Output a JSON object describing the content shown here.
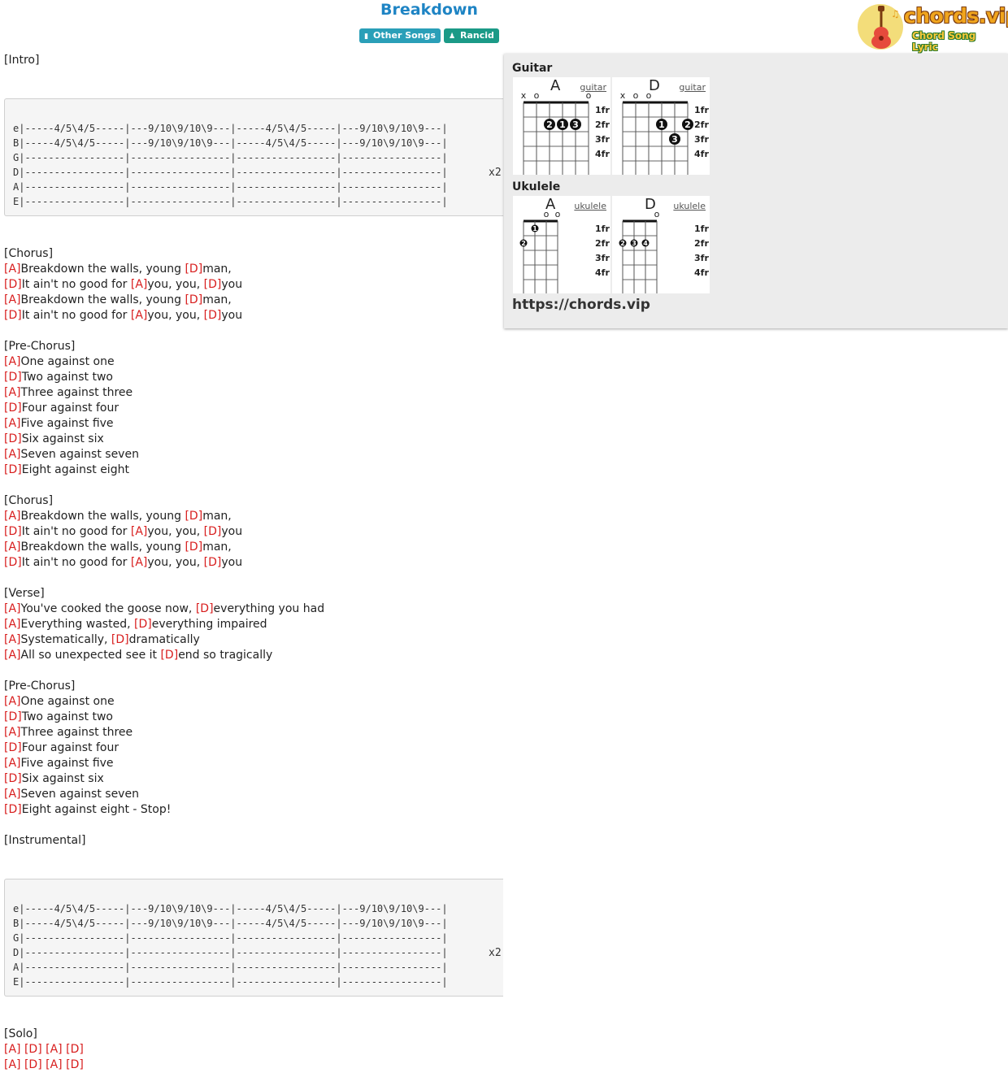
{
  "song": {
    "title": "Breakdown"
  },
  "tags": {
    "category": "Other Songs",
    "artist": "Rancid"
  },
  "logo": {
    "name": "chords.vip",
    "tagline": "Chord Song Lyric"
  },
  "panel": {
    "guitar_label": "Guitar",
    "ukulele_label": "Ukulele",
    "site_url": "https://chords.vip",
    "chords": [
      {
        "name": "A",
        "instrument": "guitar",
        "link": "guitar",
        "open_muted": [
          "x",
          "o",
          "",
          "",
          "",
          "o"
        ],
        "dots": [
          {
            "string": 2,
            "fret": 2,
            "finger": "2"
          },
          {
            "string": 3,
            "fret": 2,
            "finger": "1"
          },
          {
            "string": 4,
            "fret": 2,
            "finger": "3"
          }
        ],
        "fret_labels": [
          "1fr",
          "2fr",
          "3fr",
          "4fr"
        ]
      },
      {
        "name": "D",
        "instrument": "guitar",
        "link": "guitar",
        "open_muted": [
          "x",
          "o",
          "o",
          "",
          "",
          ""
        ],
        "dots": [
          {
            "string": 3,
            "fret": 2,
            "finger": "1"
          },
          {
            "string": 5,
            "fret": 2,
            "finger": "2"
          },
          {
            "string": 4,
            "fret": 3,
            "finger": "3"
          }
        ],
        "fret_labels": [
          "1fr",
          "2fr",
          "3fr",
          "4fr"
        ]
      },
      {
        "name": "A",
        "instrument": "ukulele",
        "link": "ukulele",
        "open_muted": [
          "",
          "",
          "o",
          "o"
        ],
        "dots": [
          {
            "string": 0,
            "fret": 2,
            "finger": "2"
          },
          {
            "string": 1,
            "fret": 1,
            "finger": "1"
          }
        ],
        "fret_labels": [
          "1fr",
          "2fr",
          "3fr",
          "4fr"
        ]
      },
      {
        "name": "D",
        "instrument": "ukulele",
        "link": "ukulele",
        "open_muted": [
          "",
          "",
          "",
          "o"
        ],
        "dots": [
          {
            "string": 0,
            "fret": 2,
            "finger": "2"
          },
          {
            "string": 1,
            "fret": 2,
            "finger": "3"
          },
          {
            "string": 2,
            "fret": 2,
            "finger": "4"
          }
        ],
        "fret_labels": [
          "1fr",
          "2fr",
          "3fr",
          "4fr"
        ]
      }
    ]
  },
  "sheet": [
    {
      "type": "line",
      "parts": [
        {
          "t": "[Intro]"
        }
      ]
    },
    {
      "type": "blank"
    },
    {
      "type": "tab",
      "lines": [
        "e|-----4/5\\4/5-----|---9/10\\9/10\\9---|-----4/5\\4/5-----|---9/10\\9/10\\9---|",
        "B|-----4/5\\4/5-----|---9/10\\9/10\\9---|-----4/5\\4/5-----|---9/10\\9/10\\9---|",
        "G|-----------------|-----------------|-----------------|-----------------|",
        "D|-----------------|-----------------|-----------------|-----------------|",
        "A|-----------------|-----------------|-----------------|-----------------|",
        "E|-----------------|-----------------|-----------------|-----------------|"
      ],
      "repeat": "x2"
    },
    {
      "type": "blank"
    },
    {
      "type": "line",
      "parts": [
        {
          "t": "[Chorus]"
        }
      ]
    },
    {
      "type": "line",
      "parts": [
        {
          "c": "[A]"
        },
        {
          "t": "Breakdown the walls, young "
        },
        {
          "c": "[D]"
        },
        {
          "t": "man,"
        }
      ]
    },
    {
      "type": "line",
      "parts": [
        {
          "c": "[D]"
        },
        {
          "t": "It ain't no good for "
        },
        {
          "c": "[A]"
        },
        {
          "t": "you, you, "
        },
        {
          "c": "[D]"
        },
        {
          "t": "you"
        }
      ]
    },
    {
      "type": "line",
      "parts": [
        {
          "c": "[A]"
        },
        {
          "t": "Breakdown the walls, young "
        },
        {
          "c": "[D]"
        },
        {
          "t": "man,"
        }
      ]
    },
    {
      "type": "line",
      "parts": [
        {
          "c": "[D]"
        },
        {
          "t": "It ain't no good for "
        },
        {
          "c": "[A]"
        },
        {
          "t": "you, you, "
        },
        {
          "c": "[D]"
        },
        {
          "t": "you"
        }
      ]
    },
    {
      "type": "blank"
    },
    {
      "type": "line",
      "parts": [
        {
          "t": "[Pre-Chorus]"
        }
      ]
    },
    {
      "type": "line",
      "parts": [
        {
          "c": "[A]"
        },
        {
          "t": "One against one"
        }
      ]
    },
    {
      "type": "line",
      "parts": [
        {
          "c": "[D]"
        },
        {
          "t": "Two against two"
        }
      ]
    },
    {
      "type": "line",
      "parts": [
        {
          "c": "[A]"
        },
        {
          "t": "Three against three"
        }
      ]
    },
    {
      "type": "line",
      "parts": [
        {
          "c": "[D]"
        },
        {
          "t": "Four against four"
        }
      ]
    },
    {
      "type": "line",
      "parts": [
        {
          "c": "[A]"
        },
        {
          "t": "Five against five"
        }
      ]
    },
    {
      "type": "line",
      "parts": [
        {
          "c": "[D]"
        },
        {
          "t": "Six against six"
        }
      ]
    },
    {
      "type": "line",
      "parts": [
        {
          "c": "[A]"
        },
        {
          "t": "Seven against seven"
        }
      ]
    },
    {
      "type": "line",
      "parts": [
        {
          "c": "[D]"
        },
        {
          "t": "Eight against eight"
        }
      ]
    },
    {
      "type": "blank"
    },
    {
      "type": "line",
      "parts": [
        {
          "t": "[Chorus]"
        }
      ]
    },
    {
      "type": "line",
      "parts": [
        {
          "c": "[A]"
        },
        {
          "t": "Breakdown the walls, young "
        },
        {
          "c": "[D]"
        },
        {
          "t": "man,"
        }
      ]
    },
    {
      "type": "line",
      "parts": [
        {
          "c": "[D]"
        },
        {
          "t": "It ain't no good for "
        },
        {
          "c": "[A]"
        },
        {
          "t": "you, you, "
        },
        {
          "c": "[D]"
        },
        {
          "t": "you"
        }
      ]
    },
    {
      "type": "line",
      "parts": [
        {
          "c": "[A]"
        },
        {
          "t": "Breakdown the walls, young "
        },
        {
          "c": "[D]"
        },
        {
          "t": "man,"
        }
      ]
    },
    {
      "type": "line",
      "parts": [
        {
          "c": "[D]"
        },
        {
          "t": "It ain't no good for "
        },
        {
          "c": "[A]"
        },
        {
          "t": "you, you, "
        },
        {
          "c": "[D]"
        },
        {
          "t": "you"
        }
      ]
    },
    {
      "type": "blank"
    },
    {
      "type": "line",
      "parts": [
        {
          "t": "[Verse]"
        }
      ]
    },
    {
      "type": "line",
      "parts": [
        {
          "c": "[A]"
        },
        {
          "t": "You've cooked the goose now, "
        },
        {
          "c": "[D]"
        },
        {
          "t": "everything you had"
        }
      ]
    },
    {
      "type": "line",
      "parts": [
        {
          "c": "[A]"
        },
        {
          "t": "Everything wasted, "
        },
        {
          "c": "[D]"
        },
        {
          "t": "everything impaired"
        }
      ]
    },
    {
      "type": "line",
      "parts": [
        {
          "c": "[A]"
        },
        {
          "t": "Systematically, "
        },
        {
          "c": "[D]"
        },
        {
          "t": "dramatically"
        }
      ]
    },
    {
      "type": "line",
      "parts": [
        {
          "c": "[A]"
        },
        {
          "t": "All so unexpected see it "
        },
        {
          "c": "[D]"
        },
        {
          "t": "end so tragically"
        }
      ]
    },
    {
      "type": "blank"
    },
    {
      "type": "line",
      "parts": [
        {
          "t": "[Pre-Chorus]"
        }
      ]
    },
    {
      "type": "line",
      "parts": [
        {
          "c": "[A]"
        },
        {
          "t": "One against one"
        }
      ]
    },
    {
      "type": "line",
      "parts": [
        {
          "c": "[D]"
        },
        {
          "t": "Two against two"
        }
      ]
    },
    {
      "type": "line",
      "parts": [
        {
          "c": "[A]"
        },
        {
          "t": "Three against three"
        }
      ]
    },
    {
      "type": "line",
      "parts": [
        {
          "c": "[D]"
        },
        {
          "t": "Four against four"
        }
      ]
    },
    {
      "type": "line",
      "parts": [
        {
          "c": "[A]"
        },
        {
          "t": "Five against five"
        }
      ]
    },
    {
      "type": "line",
      "parts": [
        {
          "c": "[D]"
        },
        {
          "t": "Six against six"
        }
      ]
    },
    {
      "type": "line",
      "parts": [
        {
          "c": "[A]"
        },
        {
          "t": "Seven against seven"
        }
      ]
    },
    {
      "type": "line",
      "parts": [
        {
          "c": "[D]"
        },
        {
          "t": "Eight against eight - Stop!"
        }
      ]
    },
    {
      "type": "blank"
    },
    {
      "type": "line",
      "parts": [
        {
          "t": "[Instrumental]"
        }
      ]
    },
    {
      "type": "blank"
    },
    {
      "type": "tab",
      "lines": [
        "e|-----4/5\\4/5-----|---9/10\\9/10\\9---|-----4/5\\4/5-----|---9/10\\9/10\\9---|",
        "B|-----4/5\\4/5-----|---9/10\\9/10\\9---|-----4/5\\4/5-----|---9/10\\9/10\\9---|",
        "G|-----------------|-----------------|-----------------|-----------------|",
        "D|-----------------|-----------------|-----------------|-----------------|",
        "A|-----------------|-----------------|-----------------|-----------------|",
        "E|-----------------|-----------------|-----------------|-----------------|"
      ],
      "repeat": "x2"
    },
    {
      "type": "blank"
    },
    {
      "type": "line",
      "parts": [
        {
          "t": "[Solo]"
        }
      ]
    },
    {
      "type": "line",
      "parts": [
        {
          "c": "[A]"
        },
        {
          "t": " "
        },
        {
          "c": "[D]"
        },
        {
          "t": " "
        },
        {
          "c": "[A]"
        },
        {
          "t": " "
        },
        {
          "c": "[D]"
        }
      ]
    },
    {
      "type": "line",
      "parts": [
        {
          "c": "[A]"
        },
        {
          "t": " "
        },
        {
          "c": "[D]"
        },
        {
          "t": " "
        },
        {
          "c": "[A]"
        },
        {
          "t": " "
        },
        {
          "c": "[D]"
        }
      ]
    }
  ]
}
